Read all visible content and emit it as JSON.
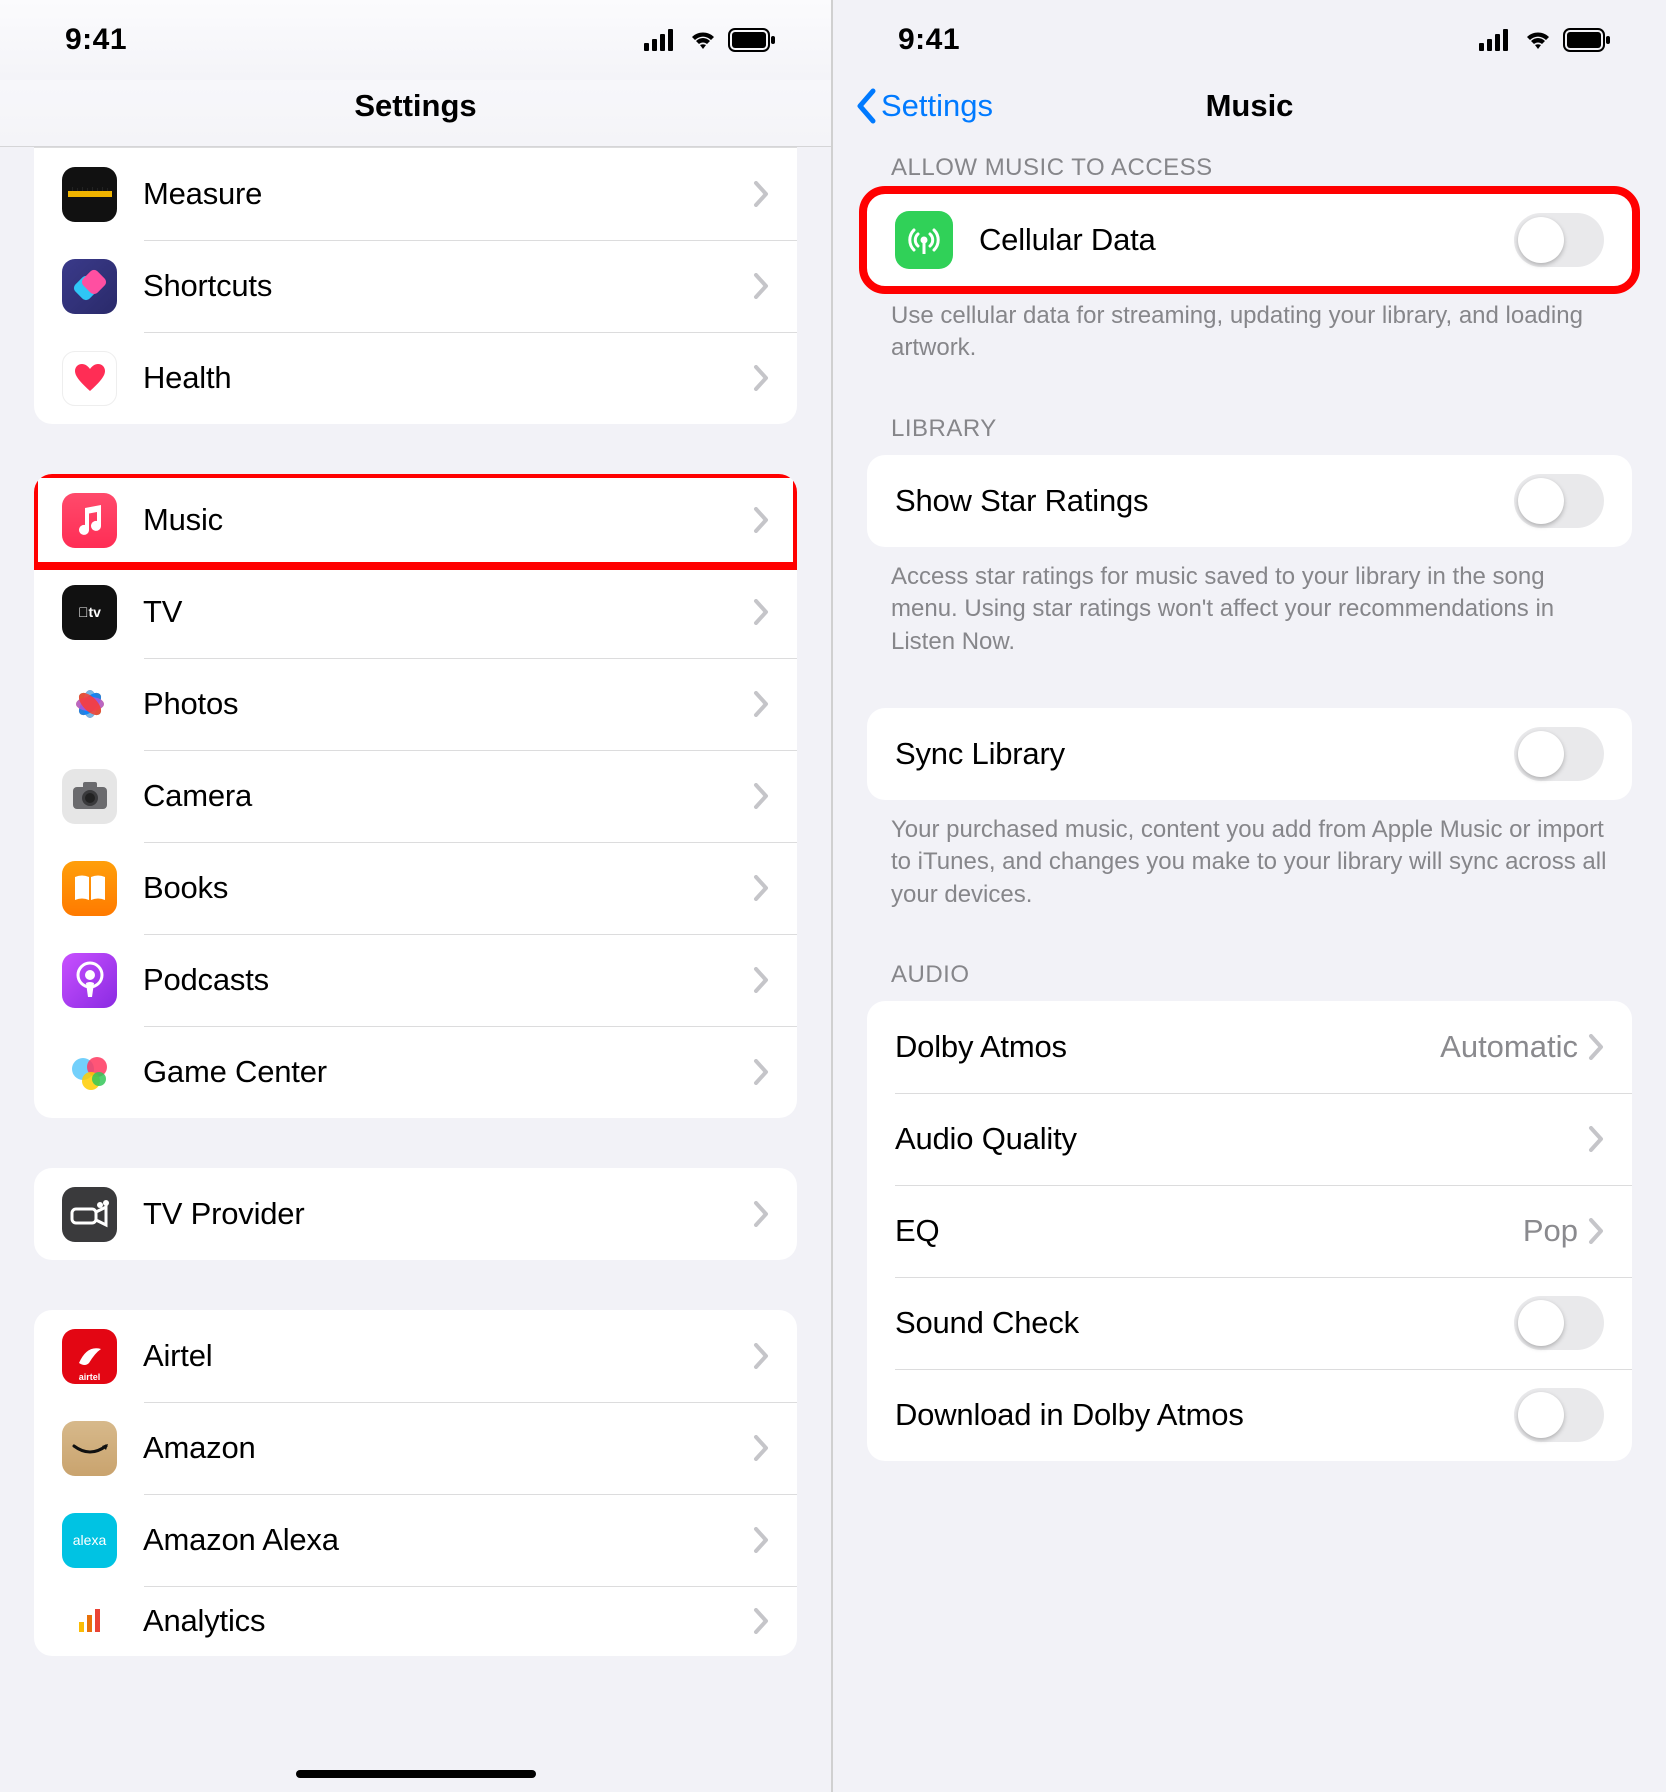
{
  "status": {
    "time": "9:41"
  },
  "left": {
    "title": "Settings",
    "group1": [
      {
        "key": "measure",
        "label": "Measure"
      },
      {
        "key": "shortcuts",
        "label": "Shortcuts"
      },
      {
        "key": "health",
        "label": "Health"
      }
    ],
    "group2": [
      {
        "key": "music",
        "label": "Music",
        "highlight": true
      },
      {
        "key": "tv",
        "label": "TV"
      },
      {
        "key": "photos",
        "label": "Photos"
      },
      {
        "key": "camera",
        "label": "Camera"
      },
      {
        "key": "books",
        "label": "Books"
      },
      {
        "key": "podcasts",
        "label": "Podcasts"
      },
      {
        "key": "gamecenter",
        "label": "Game Center"
      }
    ],
    "group3": [
      {
        "key": "tvprovider",
        "label": "TV Provider"
      }
    ],
    "group4": [
      {
        "key": "airtel",
        "label": "Airtel"
      },
      {
        "key": "amazon",
        "label": "Amazon"
      },
      {
        "key": "alexa",
        "label": "Amazon Alexa"
      },
      {
        "key": "analytics",
        "label": "Analytics"
      }
    ]
  },
  "right": {
    "back": "Settings",
    "title": "Music",
    "sections": {
      "access": {
        "header": "ALLOW MUSIC TO ACCESS",
        "cellular": "Cellular Data",
        "footer": "Use cellular data for streaming, updating your library, and loading artwork."
      },
      "library": {
        "header": "LIBRARY",
        "star": "Show Star Ratings",
        "star_footer": "Access star ratings for music saved to your library in the song menu. Using star ratings won't affect your recommendations in Listen Now.",
        "sync": "Sync Library",
        "sync_footer": "Your purchased music, content you add from Apple Music or import to iTunes, and changes you make to your library will sync across all your devices."
      },
      "audio": {
        "header": "AUDIO",
        "dolby": "Dolby Atmos",
        "dolby_value": "Automatic",
        "quality": "Audio Quality",
        "eq": "EQ",
        "eq_value": "Pop",
        "soundcheck": "Sound Check",
        "dl_dolby": "Download in Dolby Atmos"
      }
    }
  }
}
